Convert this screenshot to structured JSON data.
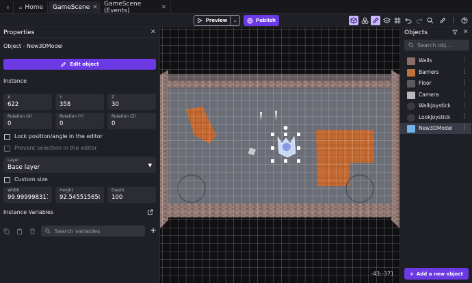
{
  "tabs": [
    {
      "label": "Home"
    },
    {
      "label": "GameScene"
    },
    {
      "label": "GameScene (Events)"
    }
  ],
  "toolbar": {
    "preview_label": "Preview",
    "publish_label": "Publish"
  },
  "properties": {
    "title": "Properties",
    "object_line": "Object  - New3DModel",
    "edit_button": "Edit object",
    "instance_section": "Instance",
    "fields": {
      "x": {
        "label": "X",
        "value": "622"
      },
      "y": {
        "label": "Y",
        "value": "358"
      },
      "z": {
        "label": "Z",
        "value": "30"
      },
      "rot_x": {
        "label": "Rotation (X)",
        "value": "0"
      },
      "rot_y": {
        "label": "Rotation (Y)",
        "value": "0"
      },
      "rot_z": {
        "label": "Rotation (Z)",
        "value": "0"
      },
      "width": {
        "label": "Width",
        "value": "99.9999983175"
      },
      "height": {
        "label": "Height",
        "value": "92.5455156500"
      },
      "depth": {
        "label": "Depth",
        "value": "100"
      }
    },
    "lock_label": "Lock position/angle in the editor",
    "prevent_label": "Prevent selection in the editor",
    "layer": {
      "label": "Layer",
      "value": "Base layer"
    },
    "custom_size_label": "Custom size",
    "instance_variables": "Instance Variables",
    "search_variables_placeholder": "Search variables"
  },
  "viewport": {
    "coordinates": "-43;-371"
  },
  "objects_panel": {
    "title": "Objects",
    "search_placeholder": "Search obj...",
    "items": [
      {
        "name": "Walls",
        "thumb_color": "#8a6e6a"
      },
      {
        "name": "Barriers",
        "thumb_color": "#c0703a"
      },
      {
        "name": "Floor",
        "thumb_color": "#5a5a5e"
      },
      {
        "name": "Camera",
        "thumb_color": "#b8b8bc"
      },
      {
        "name": "WalkJoystick",
        "thumb_color": "#3a3a40"
      },
      {
        "name": "LookJoystick",
        "thumb_color": "#3a3a40"
      },
      {
        "name": "New3DModel",
        "thumb_color": "#6fb6e8",
        "selected": true
      }
    ],
    "add_button": "Add a new object"
  },
  "colors": {
    "accent": "#6b3ae5",
    "panel": "#1f1f26",
    "viewport_bg": "#111114"
  }
}
